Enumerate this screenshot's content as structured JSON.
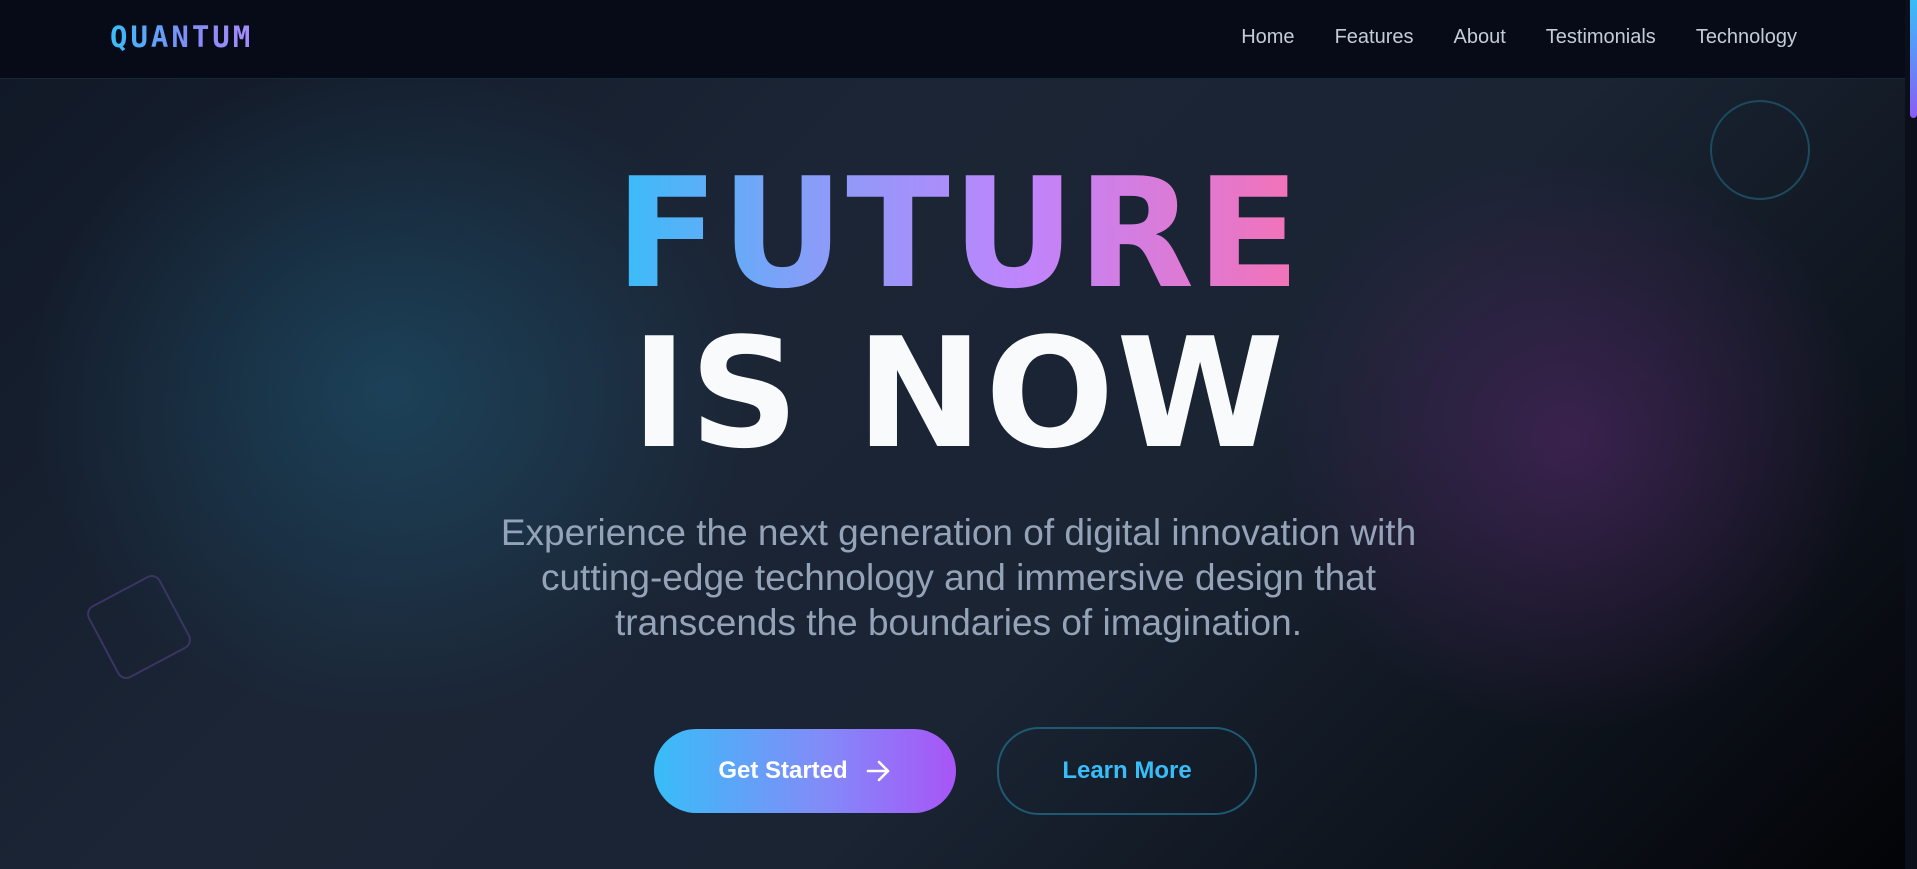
{
  "nav": {
    "logo": "QUANTUM",
    "links": [
      "Home",
      "Features",
      "About",
      "Testimonials",
      "Technology"
    ]
  },
  "hero": {
    "title_line1": "FUTURE",
    "title_line2": "IS NOW",
    "description": "Experience the next generation of digital innovation with cutting-edge technology and immersive design that transcends the boundaries of imagination.",
    "primary_button": "Get Started",
    "secondary_button": "Learn More"
  },
  "colors": {
    "accent_blue": "#38bdf8",
    "accent_purple": "#a855f7",
    "accent_pink": "#f472b6",
    "background": "#0b1220"
  },
  "icons": {
    "primary_button_icon": "arrow-right-icon"
  }
}
